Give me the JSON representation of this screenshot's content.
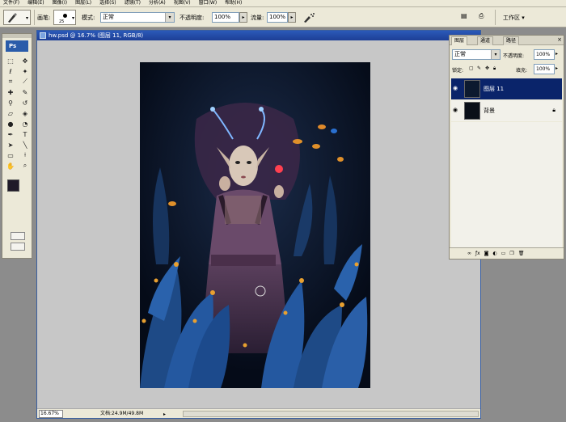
{
  "menu": [
    "文件(F)",
    "编辑(E)",
    "图像(I)",
    "图层(L)",
    "选择(S)",
    "滤镜(T)",
    "分析(A)",
    "视图(V)",
    "窗口(W)",
    "帮助(H)"
  ],
  "options": {
    "brush_label": "画笔:",
    "brush_size": "25",
    "mode_label": "模式:",
    "mode_value": "正常",
    "opacity_label": "不透明度:",
    "opacity_value": "100%",
    "flow_label": "流量:",
    "flow_value": "100%",
    "workspace_label": "工作区 ▾"
  },
  "toolbox": {
    "logo": "Ps",
    "fg_color": "#1f1a29",
    "bg_color": "#ffffff"
  },
  "document": {
    "title": "hw.psd @ 16.7% (图层 11, RGB/8)",
    "zoom": "16.67%",
    "doc_info": "文档:24.9M/49.8M"
  },
  "layers_panel": {
    "tabs": [
      "图层",
      "通道",
      "路径"
    ],
    "blend_mode": "正常",
    "opacity_label": "不透明度:",
    "opacity_value": "100%",
    "lock_label": "锁定:",
    "fill_label": "填充:",
    "fill_value": "100%",
    "layers": [
      {
        "name": "图层 11",
        "selected": true
      },
      {
        "name": "背景",
        "selected": false
      }
    ]
  }
}
